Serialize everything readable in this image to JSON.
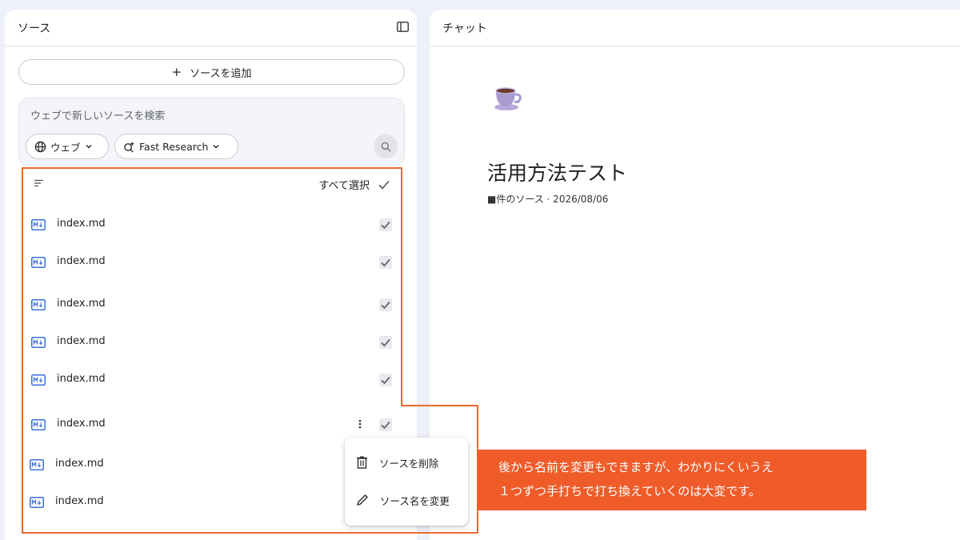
{
  "sources": {
    "title": "ソース",
    "add_button": "ソースを追加",
    "search_placeholder": "ウェブで新しいソースを検索",
    "chip_web": "ウェブ",
    "chip_research": "Fast Research",
    "select_all": "すべて選択",
    "items": [
      {
        "label": "index.md"
      },
      {
        "label": "index.md"
      },
      {
        "label": "index.md"
      },
      {
        "label": "index.md"
      },
      {
        "label": "index.md"
      },
      {
        "label": "index.md"
      },
      {
        "label": "index.md"
      },
      {
        "label": "index.md"
      }
    ]
  },
  "context_menu": {
    "delete": "ソースを削除",
    "rename": "ソース名を変更"
  },
  "chat": {
    "title": "チャット",
    "notebook_title": "活用方法テスト",
    "notebook_meta": "■件のソース · 2026/08/06"
  },
  "callout": {
    "line1": "後から名前を変更もできますが、わかりにくいうえ",
    "line2": "１つずつ手打ちで打ち換えていくのは大変です。"
  },
  "colors": {
    "accent_orange": "#ef5c2a",
    "md_icon_blue": "#3b6fd8"
  }
}
